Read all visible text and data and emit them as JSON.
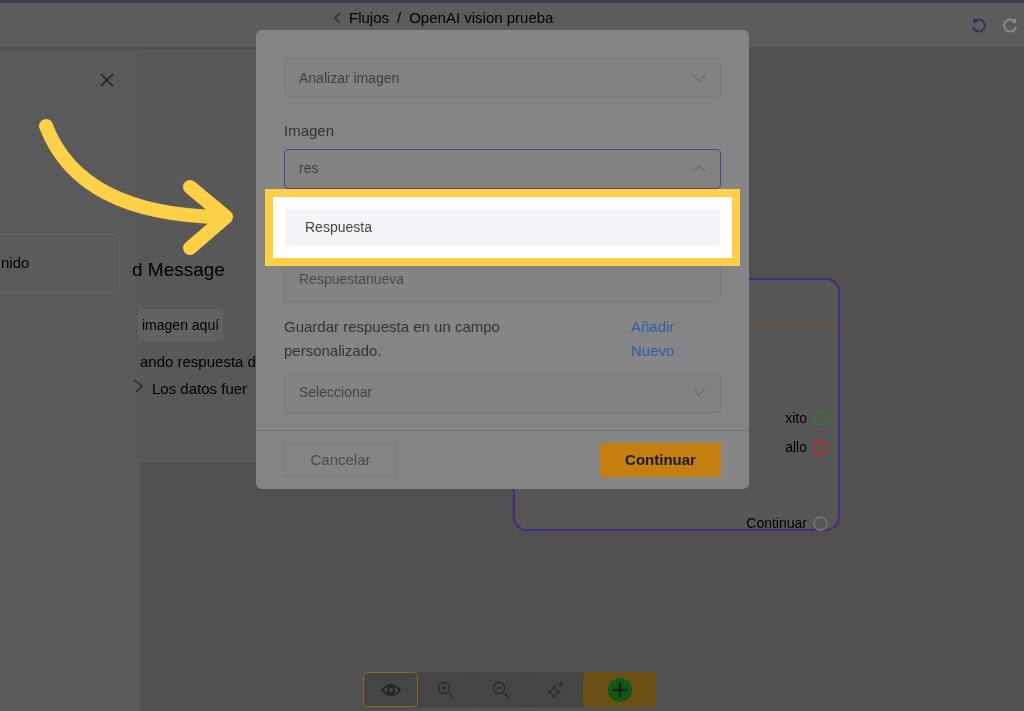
{
  "top_bar": {
    "breadcrumb": [
      {
        "label": "Flujos"
      },
      {
        "label": "OpenAI vision prueba"
      }
    ],
    "separator": "/"
  },
  "left_panel": {
    "card_text": "nido"
  },
  "middle_panel": {
    "heading": "d Message",
    "chip": "imagen aquí",
    "lines": [
      "ando respuesta d",
      "Los datos fuer"
    ]
  },
  "node": {
    "handles": [
      {
        "label": "xito",
        "color": "#2f7a2f"
      },
      {
        "label": "allo",
        "color": "#b23030"
      },
      {
        "label": "Continuar",
        "color": "#707070"
      }
    ]
  },
  "modal": {
    "action_select": {
      "value": "Analizar imagen"
    },
    "image_field": {
      "label": "Imagen",
      "value": "res",
      "expanded": true
    },
    "options": [
      {
        "label": "Respuesta",
        "selected": true
      },
      {
        "label": "Respuestanueva",
        "selected": false
      }
    ],
    "save_label": "Guardar respuesta en un campo personalizado.",
    "add_link": "Añadir Nuevo",
    "field_select": {
      "placeholder": "Seleccionar"
    },
    "buttons": [
      {
        "kind": "secondary",
        "label": "Cancelar"
      },
      {
        "kind": "primary",
        "label": "Continuar"
      }
    ]
  },
  "toolbar": [
    {
      "kind": "eye",
      "selected": true
    },
    {
      "kind": "zoom-in",
      "selected": false
    },
    {
      "kind": "zoom-out",
      "selected": false
    },
    {
      "kind": "sparkle",
      "selected": false
    },
    {
      "kind": "add",
      "selected": false
    }
  ]
}
